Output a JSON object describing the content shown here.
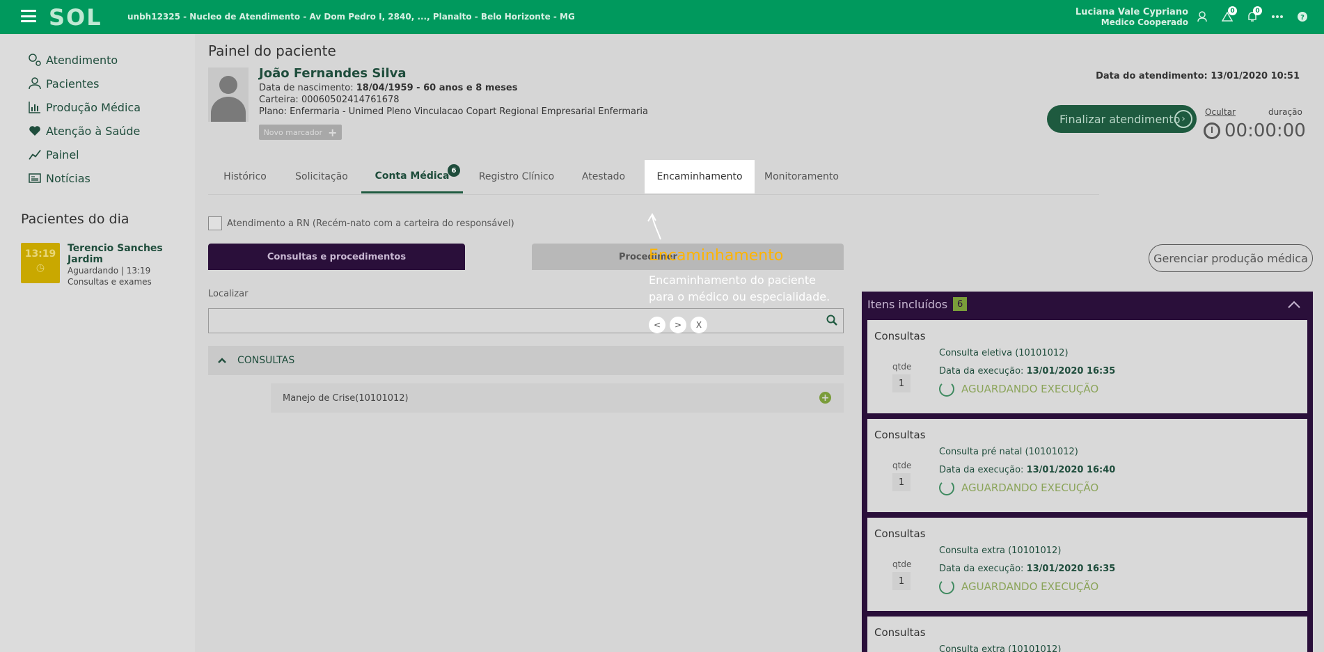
{
  "topbar": {
    "logo": "SOL",
    "unit": "unbh12325 - Nucleo de Atendimento - Av Dom Pedro I, 2840, ..., Planalto - Belo Horizonte - MG",
    "user_name": "Luciana Vale Cypriano",
    "user_role": "Medico Cooperado",
    "alert_count": "0",
    "notification_count": "0",
    "icons": [
      "menu-icon",
      "user-icon",
      "alert-icon",
      "bell-icon",
      "more-icon",
      "help-icon"
    ]
  },
  "sidebar": {
    "items": [
      {
        "label": "Atendimento",
        "icon": "stethoscope-icon"
      },
      {
        "label": "Pacientes",
        "icon": "patients-icon"
      },
      {
        "label": "Produção Médica",
        "icon": "chart-icon"
      },
      {
        "label": "Atenção à Saúde",
        "icon": "heart-icon"
      },
      {
        "label": "Painel",
        "icon": "panel-icon"
      },
      {
        "label": "Notícias",
        "icon": "news-icon"
      }
    ],
    "patients_title": "Pacientes do dia",
    "patient": {
      "time": "13:19",
      "name": "Terencio Sanches Jardim",
      "status": "Aguardando",
      "status_time": "13:19",
      "type": "Consultas e exames"
    }
  },
  "main": {
    "title": "Painel do paciente",
    "patient_name": "João Fernandes Silva",
    "birth_label": "Data de nascimento:",
    "birth_value": "18/04/1959 - 60 anos e 8 meses",
    "card_label": "Carteira:",
    "card_value": "00060502414761678",
    "plan_label": "Plano:",
    "plan_value": "Enfermaria - Unimed Pleno Vinculacao Copart Regional Empresarial Enfermaria",
    "marker_button": "Novo marcador",
    "atend_date_label": "Data do atendimento:",
    "atend_date_value": "13/01/2020 10:51",
    "finalizar_button": "Finalizar atendimento",
    "ocultar_link": "Ocultar",
    "duracao_label": "duração",
    "timer": "00:00:00",
    "tabs": [
      {
        "label": "Histórico"
      },
      {
        "label": "Solicitação"
      },
      {
        "label": "Conta Médica",
        "badge": "6"
      },
      {
        "label": "Registro Clínico"
      },
      {
        "label": "Atestado"
      },
      {
        "label": "Encaminhamento"
      },
      {
        "label": "Monitoramento"
      }
    ],
    "rn_checkbox_label": "Atendimento a RN (Recém-nato com a carteira do responsável)",
    "seg_left": "Consultas e procedimentos",
    "seg_right": "Procedimer",
    "gerenciar_button": "Gerenciar produção médica",
    "localizar_label": "Localizar",
    "localizar_value": "",
    "consultas_header": "CONSULTAS",
    "procedure_row": "Manejo de Crise(10101012)"
  },
  "itens": {
    "title": "Itens incluídos",
    "count": "6",
    "qtde_label": "qtde",
    "exec_label": "Data da execução:",
    "cards": [
      {
        "category": "Consultas",
        "name": "Consulta eletiva (10101012)",
        "exec_date": "13/01/2020 16:35",
        "qty": "1",
        "status": "AGUARDANDO EXECUÇÃO"
      },
      {
        "category": "Consultas",
        "name": "Consulta pré natal (10101012)",
        "exec_date": "13/01/2020 16:40",
        "qty": "1",
        "status": "AGUARDANDO EXECUÇÃO"
      },
      {
        "category": "Consultas",
        "name": "Consulta extra (10101012)",
        "exec_date": "13/01/2020 16:35",
        "qty": "1",
        "status": "AGUARDANDO EXECUÇÃO"
      },
      {
        "category": "Consultas",
        "name": "Consulta extra (10101012)",
        "exec_date": "",
        "qty": "",
        "status": ""
      }
    ]
  },
  "tour": {
    "title": "Encaminhamento",
    "text": "Encaminhamento do paciente para o médico ou especialidade.",
    "prev": "<",
    "next": ">",
    "close": "X"
  },
  "colors": {
    "brand_green": "#00995d",
    "tour_title": "#ffb400",
    "purple": "#2a0f3a"
  }
}
